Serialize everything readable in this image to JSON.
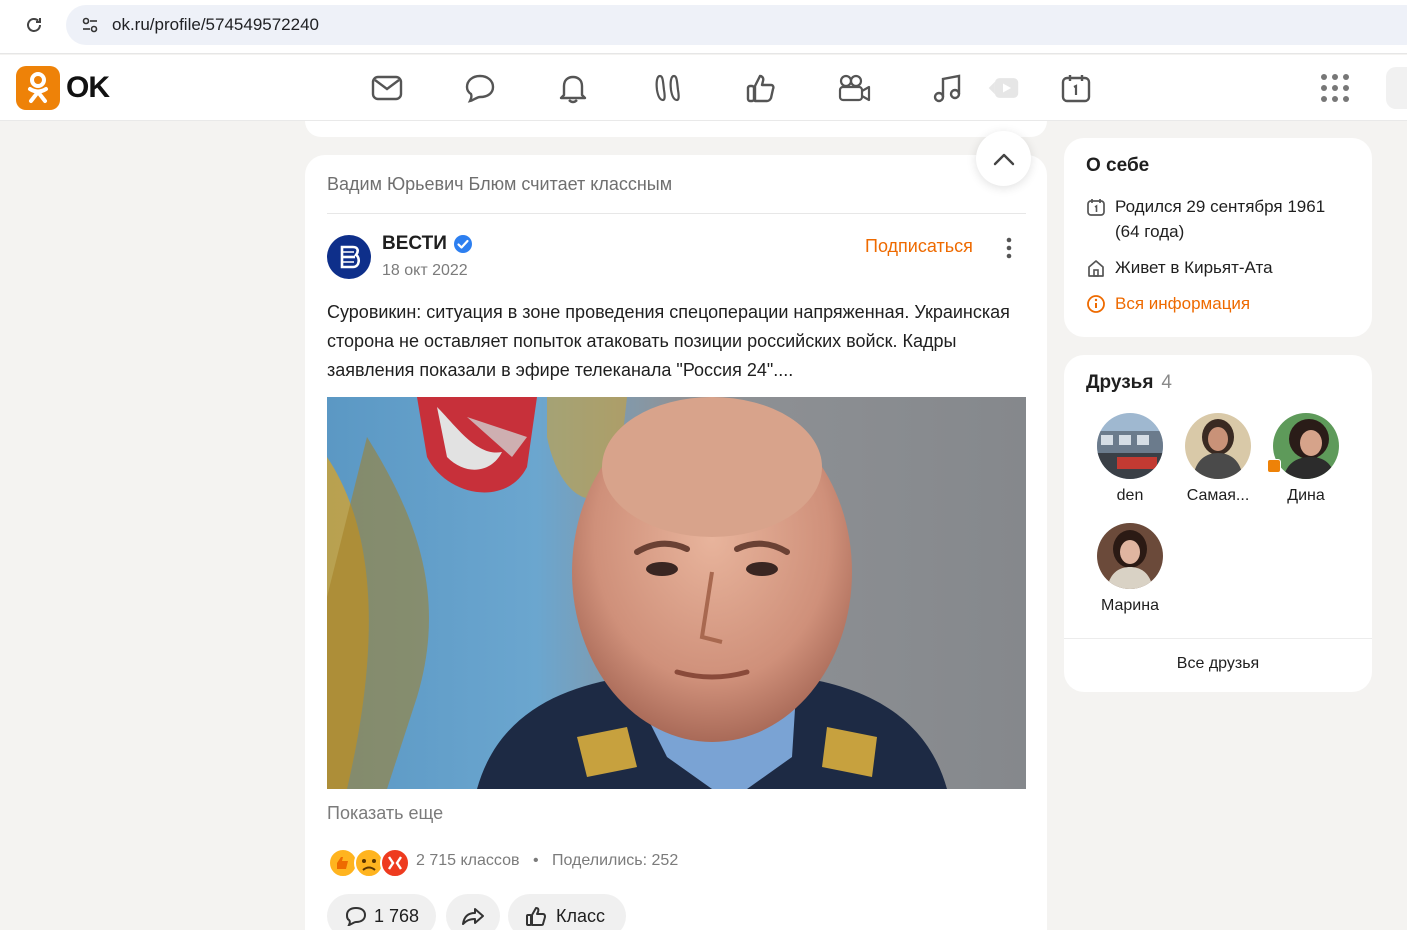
{
  "browser": {
    "url": "ok.ru/profile/574549572240"
  },
  "header": {
    "logo_text": "OK",
    "brand_color": "#ee8208",
    "nav_icons": [
      "mail-icon",
      "chat-icon",
      "bell-icon",
      "guests-icon",
      "like-icon",
      "video-camera-icon",
      "music-icon",
      "video-play-icon",
      "calendar-icon"
    ]
  },
  "feed": {
    "liked_by": "Вадим Юрьевич Блюм считает классным",
    "author": {
      "name": "ВЕСТИ",
      "date": "18 окт 2022"
    },
    "subscribe_label": "Подписаться",
    "text": "Суровикин: ситуация в зоне проведения спецоперации напряженная. Украинская сторона не оставляет попыток атаковать позиции российских войск. Кадры заявления показали в эфире телеканала \"Россия 24\"....",
    "show_more": "Показать еще",
    "likes": "2 715 классов",
    "separator": "•",
    "shares": "Поделились: 252",
    "comments_count": "1 768",
    "class_label": "Класс",
    "accent_color": "#ee6a00"
  },
  "about": {
    "title": "О себе",
    "born_line1": "Родился 29 сентября 1961",
    "born_line2": "(64 года)",
    "lives": "Живет в Кирьят-Ата",
    "all_info": "Вся информация"
  },
  "friends": {
    "title": "Друзья",
    "count": "4",
    "items": [
      {
        "name": "den"
      },
      {
        "name": "Самая..."
      },
      {
        "name": "Дина"
      },
      {
        "name": "Марина"
      }
    ],
    "all_label": "Все друзья"
  }
}
